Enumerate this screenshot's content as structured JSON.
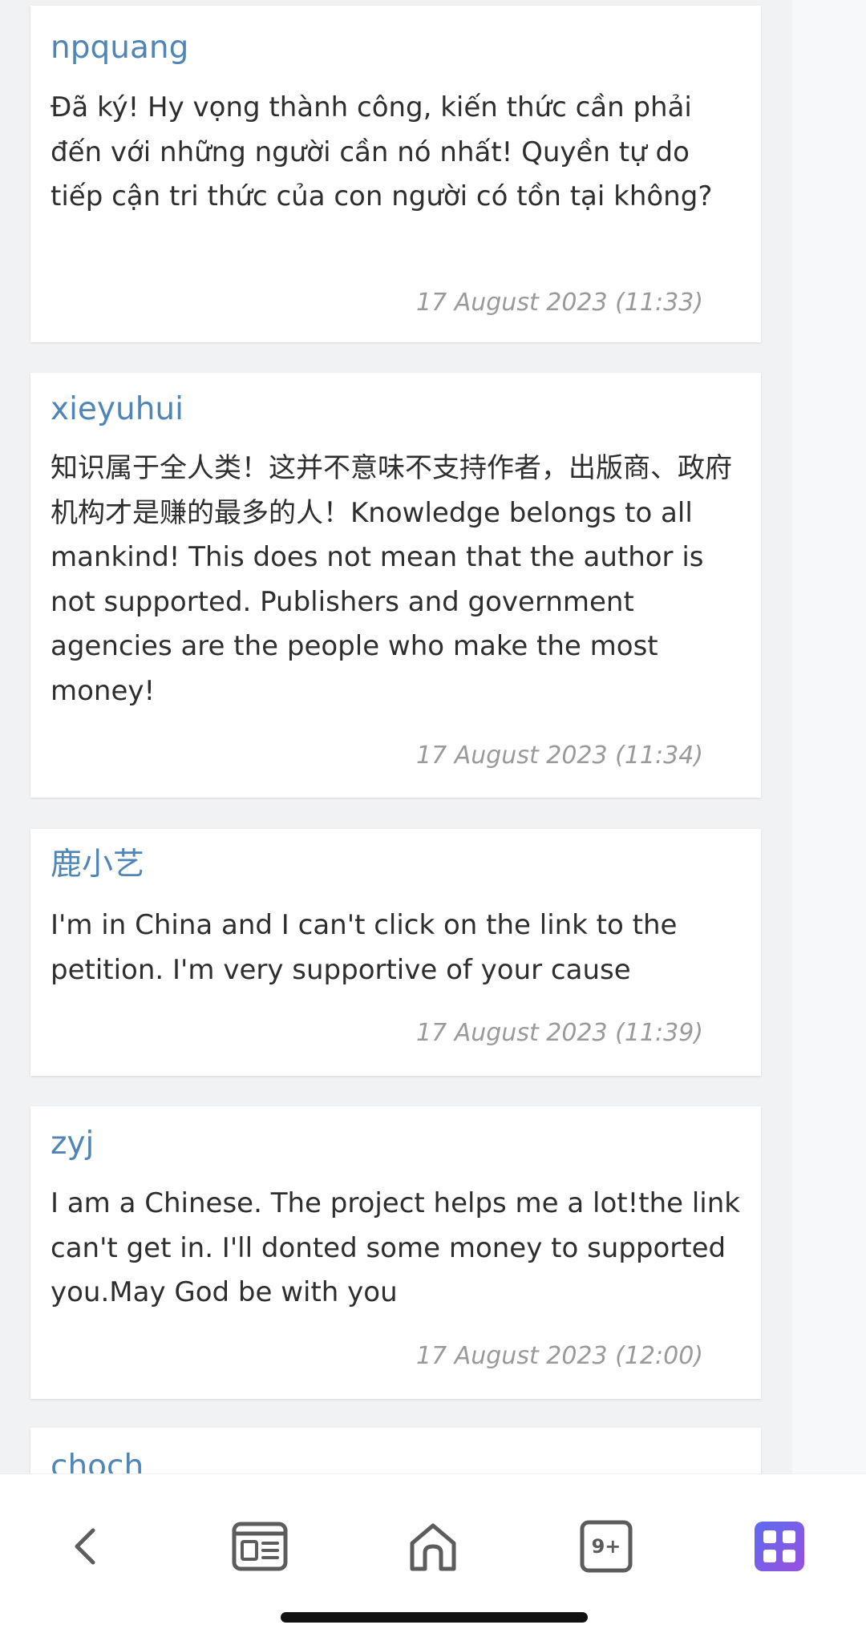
{
  "comments": [
    {
      "author": "npquang",
      "text": "Đã ký! Hy vọng thành công, kiến thức cần phải đến với những người cần nó nhất! Quyền tự do tiếp cận tri thức của con người có tồn tại không?",
      "date": "17 August 2023 (11:33)"
    },
    {
      "author": "xieyuhui",
      "text": "知识属于全人类！这并不意味不支持作者，出版商、政府机构才是赚的最多的人！Knowledge belongs to all mankind! This does not mean that the author is not supported. Publishers and government agencies are the people who make the most money!",
      "date": "17 August 2023 (11:34)"
    },
    {
      "author": "鹿小艺",
      "text": "I'm in China and I can't click on the link to the petition. I'm very supportive of your cause",
      "date": "17 August 2023 (11:39)"
    },
    {
      "author": "zyj",
      "text": "I am a Chinese. The project helps me a lot!the link can't get in. I'll donted some money to supported you.May God be with you",
      "date": "17 August 2023 (12:00)"
    },
    {
      "author": "choch"
    }
  ],
  "bottom_nav": {
    "items": [
      {
        "icon": "back-arrow-icon"
      },
      {
        "icon": "news-icon"
      },
      {
        "icon": "home-icon"
      },
      {
        "icon": "tabs-icon",
        "badge": "9+"
      },
      {
        "icon": "apps-grid-icon"
      }
    ],
    "accent_gradient": [
      "#5b6cf0",
      "#9a4fe0"
    ]
  }
}
